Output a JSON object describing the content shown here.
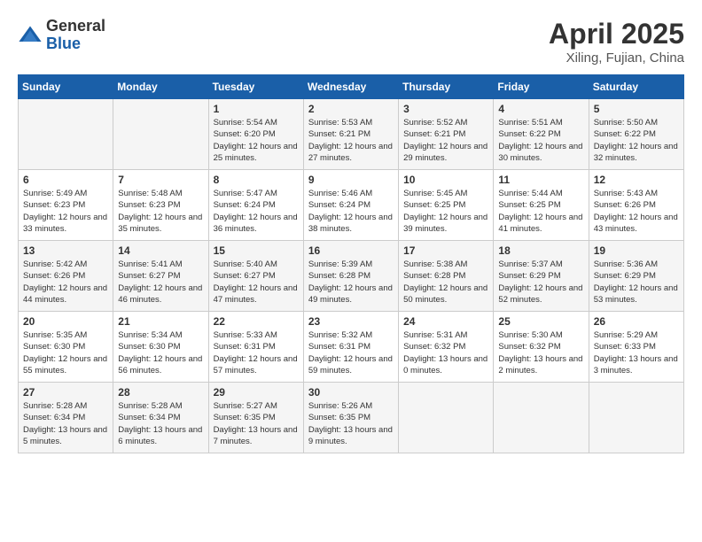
{
  "logo": {
    "general": "General",
    "blue": "Blue"
  },
  "title": "April 2025",
  "location": "Xiling, Fujian, China",
  "days_of_week": [
    "Sunday",
    "Monday",
    "Tuesday",
    "Wednesday",
    "Thursday",
    "Friday",
    "Saturday"
  ],
  "weeks": [
    [
      {
        "day": "",
        "content": ""
      },
      {
        "day": "",
        "content": ""
      },
      {
        "day": "1",
        "content": "Sunrise: 5:54 AM\nSunset: 6:20 PM\nDaylight: 12 hours and 25 minutes."
      },
      {
        "day": "2",
        "content": "Sunrise: 5:53 AM\nSunset: 6:21 PM\nDaylight: 12 hours and 27 minutes."
      },
      {
        "day": "3",
        "content": "Sunrise: 5:52 AM\nSunset: 6:21 PM\nDaylight: 12 hours and 29 minutes."
      },
      {
        "day": "4",
        "content": "Sunrise: 5:51 AM\nSunset: 6:22 PM\nDaylight: 12 hours and 30 minutes."
      },
      {
        "day": "5",
        "content": "Sunrise: 5:50 AM\nSunset: 6:22 PM\nDaylight: 12 hours and 32 minutes."
      }
    ],
    [
      {
        "day": "6",
        "content": "Sunrise: 5:49 AM\nSunset: 6:23 PM\nDaylight: 12 hours and 33 minutes."
      },
      {
        "day": "7",
        "content": "Sunrise: 5:48 AM\nSunset: 6:23 PM\nDaylight: 12 hours and 35 minutes."
      },
      {
        "day": "8",
        "content": "Sunrise: 5:47 AM\nSunset: 6:24 PM\nDaylight: 12 hours and 36 minutes."
      },
      {
        "day": "9",
        "content": "Sunrise: 5:46 AM\nSunset: 6:24 PM\nDaylight: 12 hours and 38 minutes."
      },
      {
        "day": "10",
        "content": "Sunrise: 5:45 AM\nSunset: 6:25 PM\nDaylight: 12 hours and 39 minutes."
      },
      {
        "day": "11",
        "content": "Sunrise: 5:44 AM\nSunset: 6:25 PM\nDaylight: 12 hours and 41 minutes."
      },
      {
        "day": "12",
        "content": "Sunrise: 5:43 AM\nSunset: 6:26 PM\nDaylight: 12 hours and 43 minutes."
      }
    ],
    [
      {
        "day": "13",
        "content": "Sunrise: 5:42 AM\nSunset: 6:26 PM\nDaylight: 12 hours and 44 minutes."
      },
      {
        "day": "14",
        "content": "Sunrise: 5:41 AM\nSunset: 6:27 PM\nDaylight: 12 hours and 46 minutes."
      },
      {
        "day": "15",
        "content": "Sunrise: 5:40 AM\nSunset: 6:27 PM\nDaylight: 12 hours and 47 minutes."
      },
      {
        "day": "16",
        "content": "Sunrise: 5:39 AM\nSunset: 6:28 PM\nDaylight: 12 hours and 49 minutes."
      },
      {
        "day": "17",
        "content": "Sunrise: 5:38 AM\nSunset: 6:28 PM\nDaylight: 12 hours and 50 minutes."
      },
      {
        "day": "18",
        "content": "Sunrise: 5:37 AM\nSunset: 6:29 PM\nDaylight: 12 hours and 52 minutes."
      },
      {
        "day": "19",
        "content": "Sunrise: 5:36 AM\nSunset: 6:29 PM\nDaylight: 12 hours and 53 minutes."
      }
    ],
    [
      {
        "day": "20",
        "content": "Sunrise: 5:35 AM\nSunset: 6:30 PM\nDaylight: 12 hours and 55 minutes."
      },
      {
        "day": "21",
        "content": "Sunrise: 5:34 AM\nSunset: 6:30 PM\nDaylight: 12 hours and 56 minutes."
      },
      {
        "day": "22",
        "content": "Sunrise: 5:33 AM\nSunset: 6:31 PM\nDaylight: 12 hours and 57 minutes."
      },
      {
        "day": "23",
        "content": "Sunrise: 5:32 AM\nSunset: 6:31 PM\nDaylight: 12 hours and 59 minutes."
      },
      {
        "day": "24",
        "content": "Sunrise: 5:31 AM\nSunset: 6:32 PM\nDaylight: 13 hours and 0 minutes."
      },
      {
        "day": "25",
        "content": "Sunrise: 5:30 AM\nSunset: 6:32 PM\nDaylight: 13 hours and 2 minutes."
      },
      {
        "day": "26",
        "content": "Sunrise: 5:29 AM\nSunset: 6:33 PM\nDaylight: 13 hours and 3 minutes."
      }
    ],
    [
      {
        "day": "27",
        "content": "Sunrise: 5:28 AM\nSunset: 6:34 PM\nDaylight: 13 hours and 5 minutes."
      },
      {
        "day": "28",
        "content": "Sunrise: 5:28 AM\nSunset: 6:34 PM\nDaylight: 13 hours and 6 minutes."
      },
      {
        "day": "29",
        "content": "Sunrise: 5:27 AM\nSunset: 6:35 PM\nDaylight: 13 hours and 7 minutes."
      },
      {
        "day": "30",
        "content": "Sunrise: 5:26 AM\nSunset: 6:35 PM\nDaylight: 13 hours and 9 minutes."
      },
      {
        "day": "",
        "content": ""
      },
      {
        "day": "",
        "content": ""
      },
      {
        "day": "",
        "content": ""
      }
    ]
  ]
}
